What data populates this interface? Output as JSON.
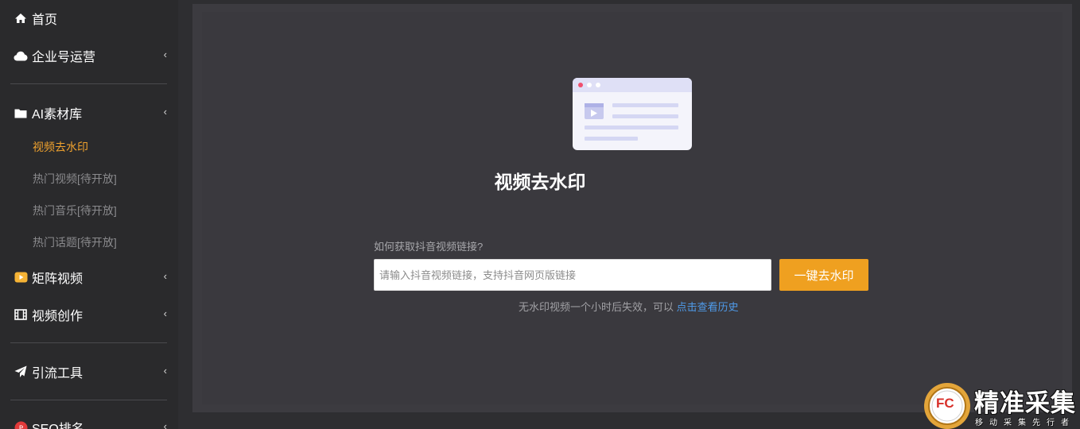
{
  "sidebar": {
    "items": [
      {
        "label": "首页",
        "icon": "home-icon"
      },
      {
        "label": "企业号运营",
        "icon": "cloud-icon"
      },
      {
        "label": "AI素材库",
        "icon": "folder-icon"
      },
      {
        "label": "矩阵视频",
        "icon": "video-play-icon"
      },
      {
        "label": "视频创作",
        "icon": "film-icon"
      },
      {
        "label": "引流工具",
        "icon": "paper-plane-icon"
      },
      {
        "label": "SEO排名",
        "icon": "seo-icon"
      }
    ],
    "sub_items": [
      {
        "label": "视频去水印",
        "active": true
      },
      {
        "label": "热门视频[待开放]",
        "active": false
      },
      {
        "label": "热门音乐[待开放]",
        "active": false
      },
      {
        "label": "热门话题[待开放]",
        "active": false
      }
    ],
    "chevron": "‹"
  },
  "main": {
    "title": "视频去水印",
    "help_link": "如何获取抖音视频链接?",
    "input_placeholder": "请输入抖音视频链接，支持抖音网页版链接",
    "button_label": "一键去水印",
    "note_prefix": "无水印视频一个小时后失效，可以",
    "note_link": "点击查看历史"
  },
  "watermark": {
    "title": "精准采集",
    "subtitle": "移动采集先行者",
    "badge": "FC"
  },
  "colors": {
    "accent": "#efa020",
    "active_text": "#f0a22e",
    "link": "#4f9bea",
    "sidebar_bg": "#2a2a2c",
    "main_bg": "#3c3b40"
  }
}
